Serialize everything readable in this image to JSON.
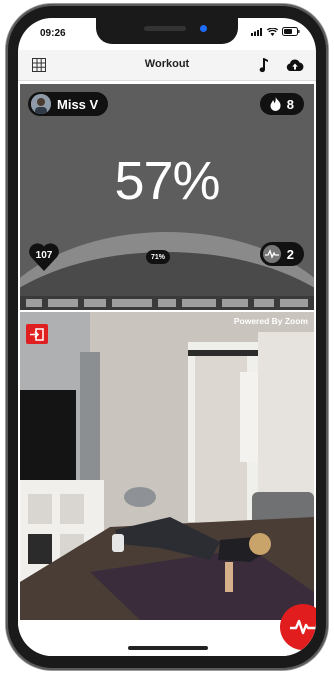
{
  "status_bar": {
    "time": "09:26"
  },
  "header": {
    "title": "Workout"
  },
  "stats": {
    "user_name": "Miss V",
    "flame_count": "8",
    "effort_percent": "57%",
    "heart_rate": "107",
    "small_badge": "71%",
    "zone_count": "2"
  },
  "video": {
    "powered_by": "Powered By Zoom"
  },
  "colors": {
    "accent_red": "#e11d1d",
    "panel_gray": "#5d5d5d",
    "pill_black": "#111111"
  },
  "icons": [
    "grid-icon",
    "music-note-icon",
    "cloud-upload-icon",
    "flame-icon",
    "heart-icon",
    "heart-rate-icon",
    "exit-icon",
    "pulse-fab-icon"
  ]
}
